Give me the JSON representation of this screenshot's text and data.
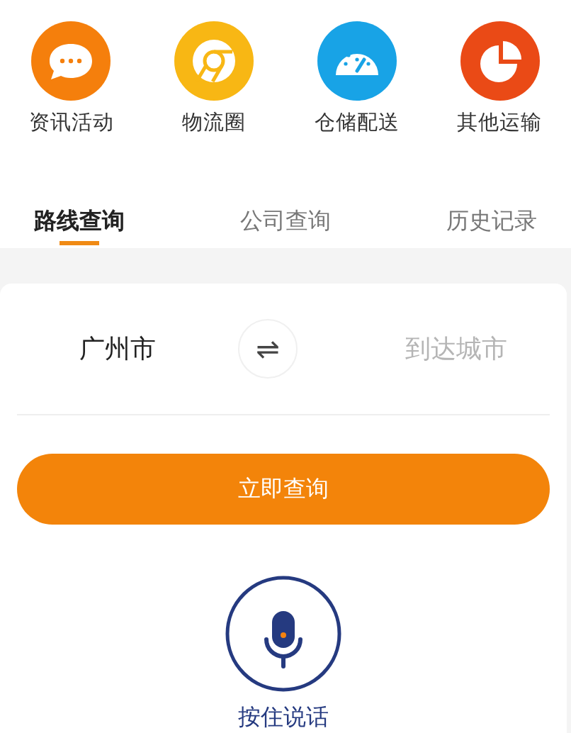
{
  "categories": [
    {
      "label": "资讯活动",
      "kind": "chat",
      "color": "#f57f0c"
    },
    {
      "label": "物流圈",
      "kind": "chrome",
      "color": "#f8b714"
    },
    {
      "label": "仓储配送",
      "kind": "gauge",
      "color": "#18a3e6"
    },
    {
      "label": "其他运输",
      "kind": "pie",
      "color": "#ea4a16"
    }
  ],
  "tabs": [
    {
      "label": "路线查询",
      "selected": true
    },
    {
      "label": "公司查询",
      "selected": false
    },
    {
      "label": "历史记录",
      "selected": false
    }
  ],
  "route": {
    "from": "广州市",
    "swap": "⇌",
    "to_placeholder": "到达城市"
  },
  "search_button": "立即查询",
  "voice": {
    "label": "按住说话"
  }
}
